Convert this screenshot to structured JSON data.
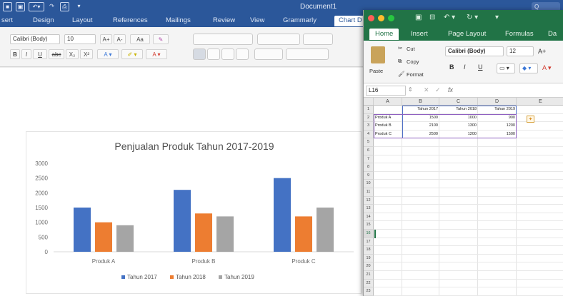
{
  "word": {
    "title": "Document1",
    "search_text": "Q",
    "tabs": [
      "sert",
      "Design",
      "Layout",
      "References",
      "Mailings",
      "Review",
      "View",
      "Grammarly",
      "Chart D"
    ],
    "ribbon": {
      "font_name": "Calibri (Body)",
      "font_size": "10",
      "text_buttons": [
        "A+",
        "A-",
        "Aa",
        "B",
        "I",
        "U",
        "abc",
        "X₂",
        "X²"
      ]
    }
  },
  "chart": {
    "title": "Penjualan Produk Tahun 2017-2019",
    "colors": [
      "#4472c4",
      "#ed7d31",
      "#a5a5a5"
    ]
  },
  "chart_data": {
    "type": "bar",
    "title": "Penjualan Produk Tahun 2017-2019",
    "categories": [
      "Produk A",
      "Produk B",
      "Produk C"
    ],
    "series": [
      {
        "name": "Tahun 2017",
        "values": [
          1500,
          2100,
          2500
        ]
      },
      {
        "name": "Tahun 2018",
        "values": [
          1000,
          1300,
          1200
        ]
      },
      {
        "name": "Tahun 2019",
        "values": [
          900,
          1200,
          1500
        ]
      }
    ],
    "ylim": [
      0,
      3000
    ],
    "yticks": [
      "0",
      "500",
      "1000",
      "1500",
      "2000",
      "2500",
      "3000"
    ],
    "legend": "bottom",
    "grid": false
  },
  "excel": {
    "tabs": [
      "Home",
      "Insert",
      "Page Layout",
      "Formulas",
      "Da"
    ],
    "ribbon": {
      "paste": "Paste",
      "cut": "Cut",
      "copy": "Copy",
      "format": "Format",
      "font_name": "Calibri (Body)",
      "font_size": "12",
      "grow": "A+",
      "bold": "B",
      "italic": "I",
      "underline": "U"
    },
    "name_box": "L16",
    "fx": "fx",
    "columns": [
      "A",
      "B",
      "C",
      "D",
      "E"
    ],
    "rows": [
      "1",
      "2",
      "3",
      "4",
      "5",
      "6",
      "7",
      "8",
      "9",
      "10",
      "11",
      "12",
      "13",
      "14",
      "15",
      "16",
      "17",
      "18",
      "19",
      "20",
      "21",
      "22",
      "23"
    ],
    "header_cells": [
      "",
      "Tahun 2017",
      "Tahun 2018",
      "Tahun 2019"
    ],
    "data_rows": [
      [
        "Produk A",
        "1500",
        "1000",
        "900"
      ],
      [
        "Produk B",
        "2100",
        "1300",
        "1200"
      ],
      [
        "Produk C",
        "2500",
        "1200",
        "1500"
      ]
    ]
  }
}
